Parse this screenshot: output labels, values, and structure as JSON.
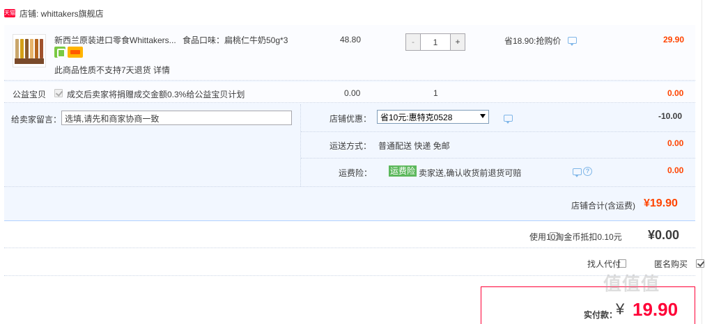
{
  "shop": {
    "badge": "天猫",
    "label": "店铺: whittakers旗舰店"
  },
  "item": {
    "title": "新西兰原装进口零食Whittakers...",
    "sku": "食品口味：扁桃仁牛奶50g*3",
    "service_icons": [
      "guarantee-icon",
      "card-icon"
    ],
    "return_note": "此商品性质不支持7天退货 详情",
    "unit_price": "48.80",
    "quantity": "1",
    "qty_minus": "-",
    "qty_plus": "+",
    "save_text": "省18.90:抢购价",
    "line_total": "29.90"
  },
  "charity": {
    "label": "公益宝贝",
    "text": "成交后卖家将捐赠成交金额0.3%给公益宝贝计划",
    "price": "0.00",
    "quantity": "1",
    "total": "0.00"
  },
  "message": {
    "label": "给卖家留言：",
    "placeholder": "选填,请先和商家协商一致"
  },
  "promo": {
    "label": "店铺优惠：",
    "selected": "省10元:惠特克0528",
    "amount": "-10.00"
  },
  "shipping": {
    "label": "运送方式：",
    "value": "普通配送 快递 免邮",
    "amount": "0.00"
  },
  "insurance": {
    "label": "运费险：",
    "badge": "运费险",
    "text": "卖家送,确认收货前退货可赔",
    "amount": "0.00"
  },
  "subtotal": {
    "label": "店铺合计(含运费)",
    "amount": "¥19.90"
  },
  "coins": {
    "text": "使用10淘金币抵扣0.10元",
    "amount": "¥0.00"
  },
  "options": {
    "proxy_label": "找人代付",
    "anonymous_label": "匿名购买"
  },
  "payment": {
    "label": "实付款：",
    "yen": "¥",
    "amount": "19.90"
  },
  "watermark": "值值值",
  "colors": {
    "accent": "#ff0036",
    "price": "#ff4400",
    "panel": "#f2f7ff",
    "border": "#b2d1ff",
    "badge_green": "#5cb85c"
  }
}
